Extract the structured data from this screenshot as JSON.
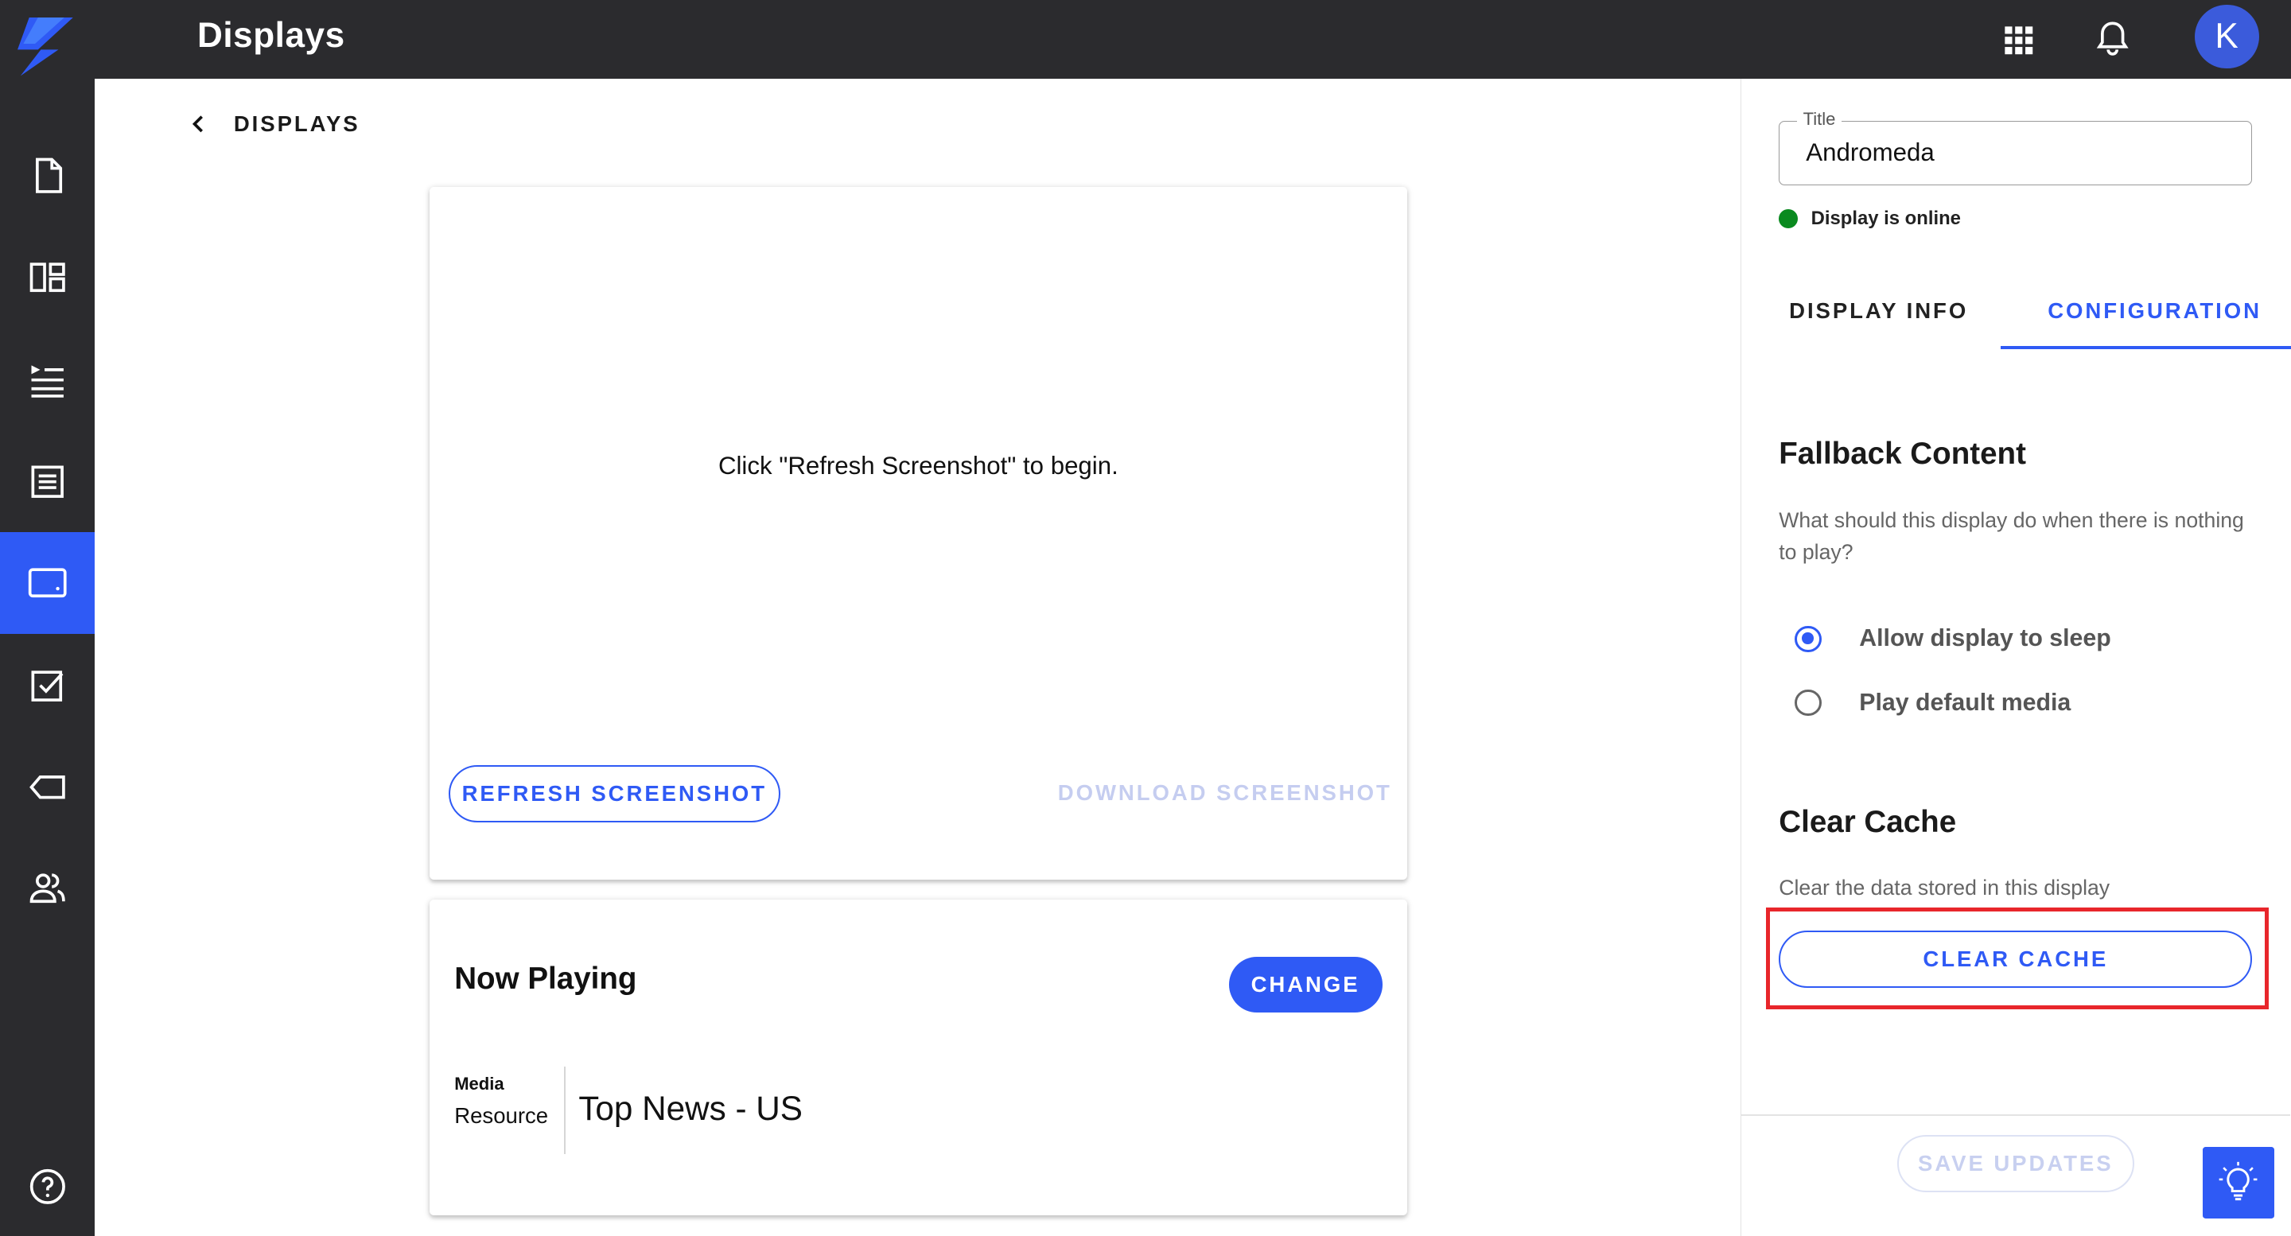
{
  "header": {
    "title": "Displays",
    "avatar_initial": "K"
  },
  "sidebar": {
    "items": [
      {
        "icon": "file-icon"
      },
      {
        "icon": "layout-icon"
      },
      {
        "icon": "playlist-icon"
      },
      {
        "icon": "list-box-icon"
      },
      {
        "icon": "display-icon",
        "active": true
      },
      {
        "icon": "checkbox-icon"
      },
      {
        "icon": "tag-icon"
      },
      {
        "icon": "users-icon"
      }
    ],
    "help_icon": "help-icon"
  },
  "breadcrumb": {
    "back_label": "DISPLAYS"
  },
  "screenshot": {
    "message": "Click \"Refresh Screenshot\" to begin.",
    "refresh_label": "REFRESH SCREENSHOT",
    "download_label": "DOWNLOAD SCREENSHOT"
  },
  "now_playing": {
    "title": "Now Playing",
    "change_label": "CHANGE",
    "media_label": "Media",
    "resource_label": "Resource",
    "value": "Top News - US"
  },
  "panel": {
    "title_label": "Title",
    "title_value": "Andromeda",
    "status_text": "Display is online",
    "status_color": "#0a8a1f",
    "tabs": [
      {
        "label": "DISPLAY INFO",
        "active": false
      },
      {
        "label": "CONFIGURATION",
        "active": true
      }
    ],
    "fallback": {
      "title": "Fallback Content",
      "description": "What should this display do when there is nothing to play?",
      "options": [
        {
          "label": "Allow display to sleep",
          "checked": true
        },
        {
          "label": "Play default media",
          "checked": false
        }
      ]
    },
    "cache": {
      "title": "Clear Cache",
      "description": "Clear the data stored in this display",
      "button_label": "CLEAR CACHE"
    },
    "save_label": "SAVE UPDATES"
  },
  "colors": {
    "accent": "#2f5af5",
    "topbar": "#2b2b2e",
    "highlight": "#e8262b"
  }
}
